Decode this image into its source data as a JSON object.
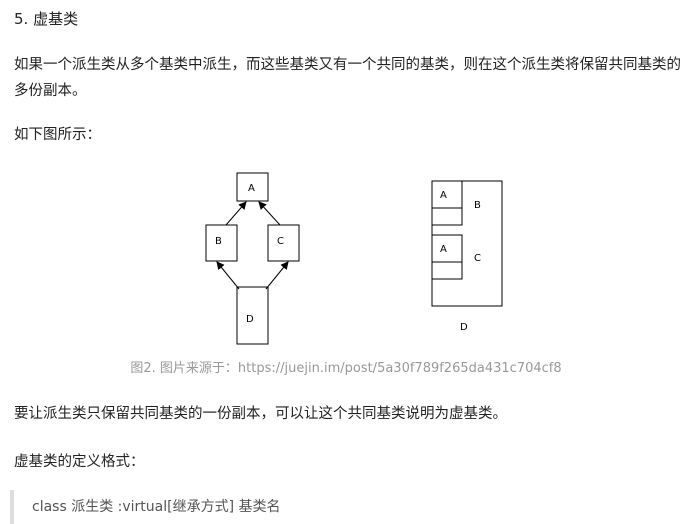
{
  "heading": "5. 虚基类",
  "paragraph1": "如果一个派生类从多个基类中派生，而这些基类又有一个共同的基类，则在这个派生类将保留共同基类的多份副本。",
  "paragraph2": "如下图所示：",
  "figure": {
    "left_diagram": {
      "a": "A",
      "b": "B",
      "c": "C",
      "d": "D"
    },
    "right_diagram": {
      "a1": "A",
      "b": "B",
      "a2": "A",
      "c": "C",
      "d": "D"
    },
    "caption": "图2. 图片来源于：https://juejin.im/post/5a30f789f265da431c704cf8"
  },
  "paragraph3": "要让派生类只保留共同基类的一份副本，可以让这个共同基类说明为虚基类。",
  "paragraph4": "虚基类的定义格式：",
  "quote": "class 派生类 :virtual[继承方式] 基类名"
}
